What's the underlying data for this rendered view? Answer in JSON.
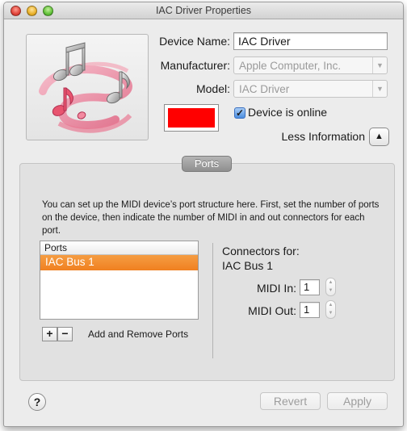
{
  "window": {
    "title": "IAC Driver Properties"
  },
  "device": {
    "name_label": "Device Name:",
    "name_value": "IAC Driver",
    "manufacturer_label": "Manufacturer:",
    "manufacturer_value": "Apple Computer, Inc.",
    "model_label": "Model:",
    "model_value": "IAC Driver",
    "online_label": "Device is online",
    "online_checked": true,
    "color": "#ff0000",
    "info_toggle_label": "Less Information"
  },
  "ports": {
    "tab_label": "Ports",
    "description": "You can set up the MIDI device’s port structure here.  First, set the number of ports on the device, then indicate the number of MIDI in and out connectors for each port.",
    "list_header": "Ports",
    "items": [
      "IAC Bus 1"
    ],
    "add_remove_label": "Add and Remove Ports",
    "add_symbol": "+",
    "remove_symbol": "−",
    "connectors_label": "Connectors for:",
    "connectors_port": "IAC Bus 1",
    "midi_in_label": "MIDI In:",
    "midi_in_value": "1",
    "midi_out_label": "MIDI Out:",
    "midi_out_value": "1"
  },
  "footer": {
    "help_symbol": "?",
    "revert_label": "Revert",
    "apply_label": "Apply"
  },
  "colors": {
    "selection": "#f08020",
    "device_color": "#ff0000"
  }
}
